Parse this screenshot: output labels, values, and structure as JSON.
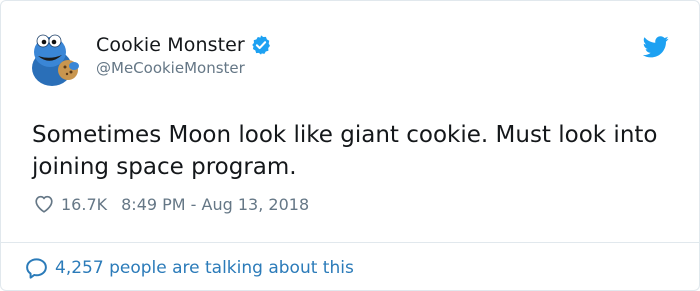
{
  "tweet": {
    "author": {
      "display_name": "Cookie Monster",
      "handle": "@MeCookieMonster",
      "verified": true,
      "avatar_icon": "cookie-monster-avatar"
    },
    "text": "Sometimes Moon look like giant cookie. Must look into joining space program.",
    "likes": "16.7K",
    "timestamp": "8:49 PM - Aug 13, 2018",
    "discussion": "4,257 people are talking about this"
  },
  "icons": {
    "brand": "twitter-bird-icon",
    "like": "heart-icon",
    "reply": "speech-bubble-icon",
    "verified": "verified-badge-icon"
  },
  "colors": {
    "brand_blue": "#1da1f2",
    "link_blue": "#2b7bb9",
    "secondary_text": "#657786",
    "primary_text": "#14171a",
    "border": "#e1e8ed"
  }
}
